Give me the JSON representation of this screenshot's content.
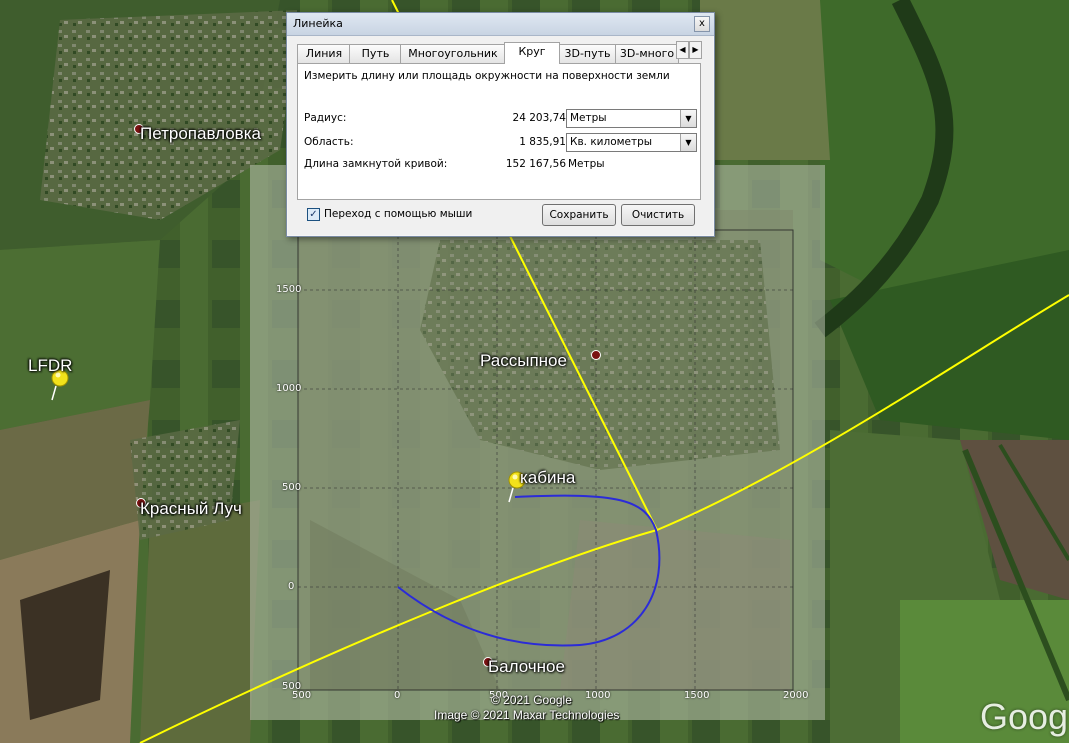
{
  "map": {
    "places": [
      {
        "name": "Петропавловка"
      },
      {
        "name": "Красный Луч"
      },
      {
        "name": "Рассыпное"
      },
      {
        "name": "Балочное"
      }
    ],
    "pins": [
      {
        "name": "LFDR"
      },
      {
        "name": "кабина"
      }
    ],
    "overlay_ticks": {
      "x": [
        "500",
        "0",
        "500",
        "1000",
        "1500",
        "2000"
      ],
      "y": [
        "1500",
        "1000",
        "500",
        "0",
        "500"
      ]
    },
    "copyright": [
      "© 2021 Google",
      "Image © 2021 Maxar Technologies"
    ],
    "watermark": "Goog",
    "colors": {
      "measure_line": "#ffff00",
      "track": "#2b2bd8"
    }
  },
  "ruler": {
    "title": "Линейка",
    "close_label": "x",
    "tabs": [
      {
        "label": "Линия"
      },
      {
        "label": "Путь"
      },
      {
        "label": "Многоугольник"
      },
      {
        "label": "Круг"
      },
      {
        "label": "3D-путь"
      },
      {
        "label": "3D-много"
      }
    ],
    "active_tab": "Круг",
    "description": "Измерить длину или площадь окружности на поверхности земли",
    "radius": {
      "label": "Радиус:",
      "value": "24 203,74",
      "unit": "Метры"
    },
    "area": {
      "label": "Область:",
      "value": "1 835,91",
      "unit": "Кв. километры"
    },
    "perimeter": {
      "label": "Длина замкнутой кривой:",
      "value": "152 167,56",
      "unit": "Метры"
    },
    "mouse_nav": {
      "label": "Переход с помощью мыши",
      "checked": true
    },
    "save_label": "Сохранить",
    "clear_label": "Очистить"
  }
}
